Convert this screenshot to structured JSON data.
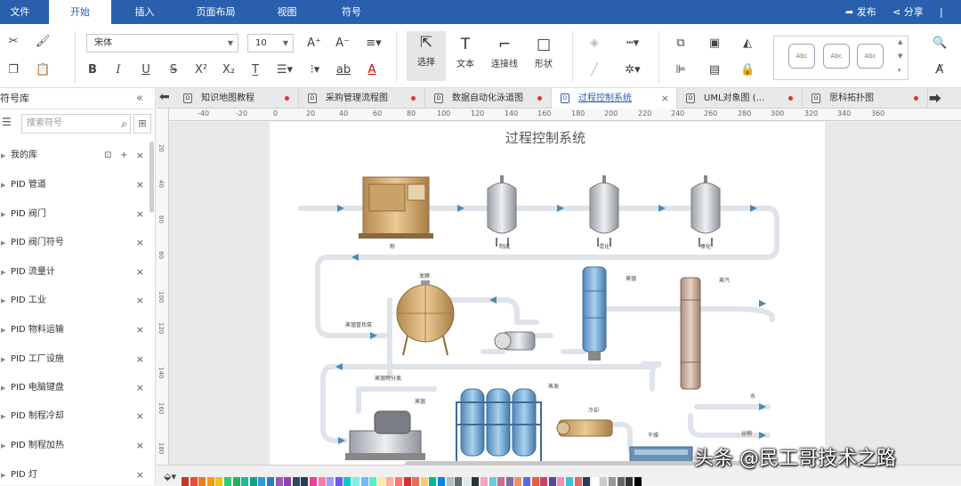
{
  "menu": {
    "items": [
      "文件",
      "开始",
      "插入",
      "页面布局",
      "视图",
      "符号"
    ],
    "active": "开始",
    "publish": "发布",
    "share": "分享"
  },
  "ribbon": {
    "font_name": "宋体",
    "font_size": "10",
    "select_label": "选择",
    "text_label": "文本",
    "connector_label": "连接线",
    "shape_label": "形状",
    "style_samples": [
      "Abc",
      "Abc",
      "Abc"
    ]
  },
  "library": {
    "title": "符号库",
    "search_placeholder": "搜索符号",
    "items": [
      "我的库",
      "PID 管道",
      "PID 阀门",
      "PID 阀门符号",
      "PID 流量计",
      "PID 工业",
      "PID 物料运输",
      "PID 工厂设施",
      "PID 电脑键盘",
      "PID 制程冷却",
      "PID 制程加热",
      "PID 灯"
    ]
  },
  "tabs": [
    {
      "name": "知识地图教程",
      "active": false
    },
    {
      "name": "采购管理流程图",
      "active": false
    },
    {
      "name": "数据自动化泳道图",
      "active": false
    },
    {
      "name": "过程控制系统",
      "active": true
    },
    {
      "name": "UML对象图 (...",
      "active": false
    },
    {
      "name": "思科拓扑图",
      "active": false
    }
  ],
  "ruler": {
    "h_ticks": [
      "-40",
      "-20",
      "0",
      "20",
      "40",
      "60",
      "80",
      "100",
      "120",
      "140",
      "160",
      "180",
      "200",
      "220",
      "240",
      "260",
      "280",
      "300",
      "320",
      "340",
      "360"
    ],
    "v_ticks": [
      "20",
      "40",
      "60",
      "80",
      "100",
      "120",
      "140",
      "160",
      "180"
    ]
  },
  "diagram": {
    "title": "过程控制系统",
    "labels": [
      "粉",
      "制成",
      "混化",
      "棒化",
      "发酵",
      "蒸馏",
      "蒸汽",
      "蒸馏冒热泵",
      "蒸馏物分离",
      "蒸馏",
      "蒸发",
      "冷却",
      "干燥",
      "水",
      "谷物"
    ]
  },
  "colors": {
    "menubar": "#2a5fae",
    "pipe": "#dfe3ea",
    "arrow": "#4a8ab5",
    "tank_silver": "#c9ccd2",
    "tank_blue": "#7fb1d8",
    "tank_wood": "#d7b27e"
  },
  "palette": [
    "#c0392b",
    "#e74c3c",
    "#e67e22",
    "#f39c12",
    "#f1c40f",
    "#2ecc71",
    "#27ae60",
    "#1abc9c",
    "#16a085",
    "#3498db",
    "#2980b9",
    "#9b59b6",
    "#8e44ad",
    "#34495e",
    "#2c3e50",
    "#e84393",
    "#fd79a8",
    "#a29bfe",
    "#6c5ce7",
    "#00cec9",
    "#81ecec",
    "#74b9ff",
    "#55efc4",
    "#ffeaa7",
    "#fab1a0",
    "#ff7675",
    "#d63031",
    "#e17055",
    "#fdcb6e",
    "#00b894",
    "#0984e3",
    "#b2bec3",
    "#636e72",
    "#dfe6e9",
    "#2d3436",
    "#f8a5c2",
    "#63cdda",
    "#cf6a87",
    "#786fa6",
    "#f19066",
    "#546de5",
    "#e15f41",
    "#c44569",
    "#574b90",
    "#f78fb3",
    "#3dc1d3",
    "#e66767",
    "#303952",
    "#ffffff",
    "#cccccc",
    "#999999",
    "#666666",
    "#333333",
    "#000000"
  ],
  "watermark": "头条 @民工哥技术之路"
}
